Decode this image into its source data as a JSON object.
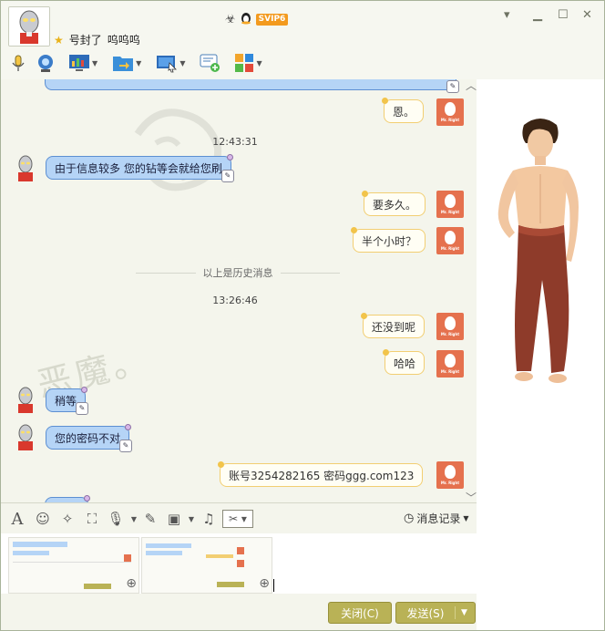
{
  "header": {
    "svip_badge": "SVIP6",
    "nickname": "号封了",
    "signature": "呜呜呜",
    "star_icon": "star-icon",
    "window_controls": [
      "minimize",
      "maximize",
      "close"
    ]
  },
  "toolbar": {
    "icons": [
      "microphone-icon",
      "camera-icon",
      "screen-share-icon",
      "file-transfer-icon",
      "remote-desktop-icon",
      "add-contact-icon",
      "apps-icon"
    ]
  },
  "chat": {
    "timestamp_1": "12:43:31",
    "timestamp_2": "13:26:46",
    "history_label": "以上是历史消息",
    "avatar_label": "Mr. Right",
    "watermark": "恶魔。",
    "messages": [
      {
        "side": "right",
        "text": "恩。"
      },
      {
        "side": "left",
        "text": "由于信息较多 您的钻等会就给您刷"
      },
      {
        "side": "right",
        "text": "要多久。"
      },
      {
        "side": "right",
        "text": "半个小时？"
      },
      {
        "side": "right",
        "text": "还没到呢"
      },
      {
        "side": "right",
        "text": "哈哈"
      },
      {
        "side": "left",
        "text": "稍等"
      },
      {
        "side": "left",
        "text": "您的密码不对"
      },
      {
        "side": "right",
        "text": "账号3254282165    密码ggg.com123"
      }
    ]
  },
  "input_toolbar": {
    "message_record": "消息记录",
    "icons": [
      "font-icon",
      "emoji-icon",
      "magic-icon",
      "screenshot-icon",
      "voice-icon",
      "handwrite-icon",
      "image-icon",
      "music-icon",
      "scissors-icon"
    ]
  },
  "buttons": {
    "close": "关闭(C)",
    "send": "发送(S)"
  },
  "colors": {
    "bubble_left_bg": "#b5d4f6",
    "bubble_right_bg": "#fffef4",
    "button_bg": "#b9b256",
    "avatar_red": "#e5714e"
  }
}
